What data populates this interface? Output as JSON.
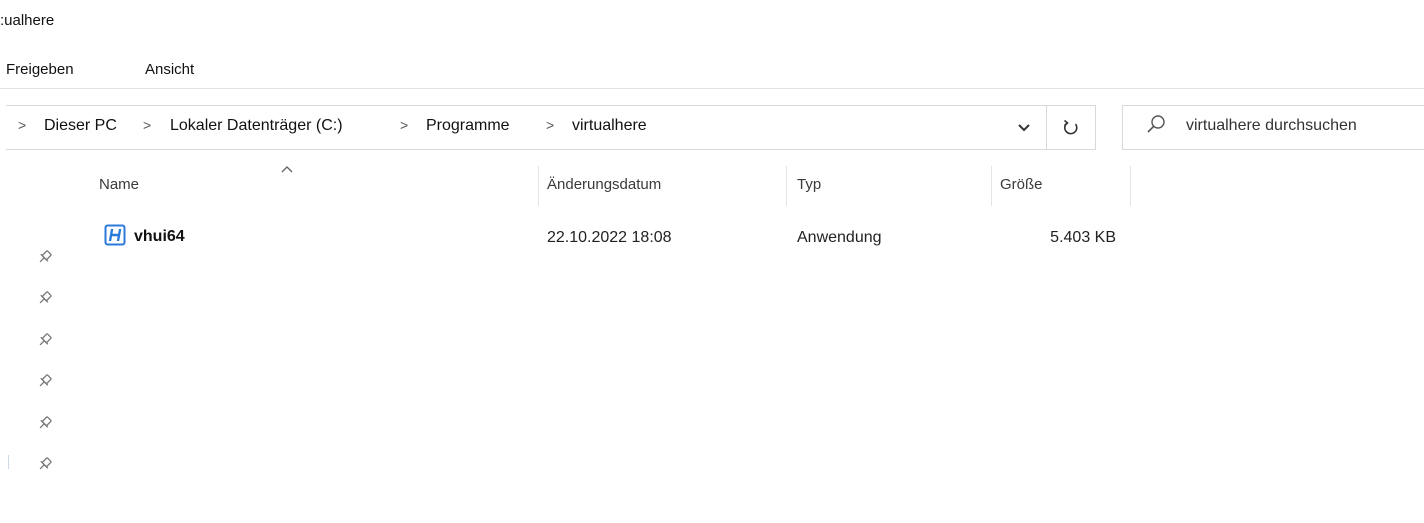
{
  "window": {
    "title": ":ualhere"
  },
  "ribbon": {
    "tabs": [
      "Freigeben",
      "Ansicht"
    ]
  },
  "address": {
    "lead_chevron": ">",
    "separator": ">",
    "crumbs": [
      "Dieser PC",
      "Lokaler Datenträger (C:)",
      "Programme",
      "virtualhere"
    ]
  },
  "search": {
    "placeholder": "virtualhere durchsuchen"
  },
  "columns": {
    "name": "Name",
    "date": "Änderungsdatum",
    "type": "Typ",
    "size": "Größe"
  },
  "files": [
    {
      "name": "vhui64",
      "date": "22.10.2022 18:08",
      "type": "Anwendung",
      "size": "5.403 KB"
    }
  ],
  "quick_access_pins": 6,
  "colors": {
    "accent": "#2b79d8",
    "border": "#d9d9d9",
    "text": "#1a1a1a"
  },
  "icons": [
    "chevron-down-icon",
    "refresh-icon",
    "search-icon",
    "sort-ascending-icon",
    "application-icon",
    "pin-icon"
  ]
}
